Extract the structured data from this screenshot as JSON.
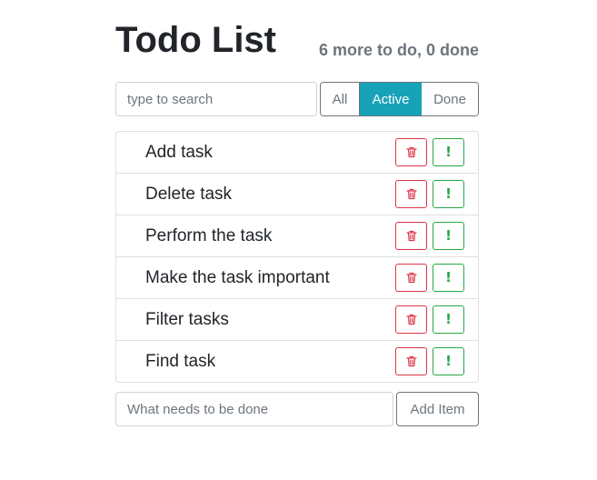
{
  "header": {
    "title": "Todo List",
    "counter": "6 more to do, 0 done"
  },
  "search": {
    "placeholder": "type to search",
    "value": ""
  },
  "filters": {
    "all": "All",
    "active": "Active",
    "done": "Done",
    "selected": "Active"
  },
  "tasks": [
    {
      "label": "Add task"
    },
    {
      "label": "Delete task"
    },
    {
      "label": "Perform the task"
    },
    {
      "label": "Make the task important"
    },
    {
      "label": "Filter tasks"
    },
    {
      "label": "Find task"
    }
  ],
  "task_buttons": {
    "delete_icon": "trash-icon",
    "important_icon": "exclamation-icon",
    "important_glyph": "!"
  },
  "add_form": {
    "placeholder": "What needs to be done",
    "value": "",
    "button_label": "Add Item"
  },
  "colors": {
    "active_filter": "#17a2b8",
    "delete": "#dc3545",
    "important": "#28a745",
    "muted": "#6c757d"
  }
}
